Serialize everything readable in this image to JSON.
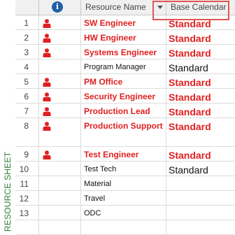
{
  "side_label": "RESOURCE SHEET",
  "header": {
    "info_symbol": "i",
    "resource_name": "Resource Name",
    "base_calendar": "Base Calendar"
  },
  "colors": {
    "overallocated_text": "#e02020",
    "normal_text": "#111111",
    "side_label": "#2e7d32",
    "highlight_box": "#e05555",
    "info_icon": "#1f5fa8"
  },
  "rows": [
    {
      "num": "1",
      "name": "SW Engineer",
      "calendar": "Standard",
      "icon": "person-icon",
      "overallocated": true
    },
    {
      "num": "2",
      "name": "HW Engineer",
      "calendar": "Standard",
      "icon": "person-icon",
      "overallocated": true
    },
    {
      "num": "3",
      "name": "Systems Engineer",
      "calendar": "Standard",
      "icon": "person-icon",
      "overallocated": true
    },
    {
      "num": "4",
      "name": "Program Manager",
      "calendar": "Standard",
      "icon": "",
      "overallocated": false
    },
    {
      "num": "5",
      "name": "PM Office",
      "calendar": "Standard",
      "icon": "person-icon",
      "overallocated": true
    },
    {
      "num": "6",
      "name": "Security Engineer",
      "calendar": "Standard",
      "icon": "person-icon",
      "overallocated": true
    },
    {
      "num": "7",
      "name": "Production Lead",
      "calendar": "Standard",
      "icon": "person-icon",
      "overallocated": true
    },
    {
      "num": "8",
      "name": "Production Support",
      "calendar": "Standard",
      "icon": "person-icon",
      "overallocated": true
    },
    {
      "num": "9",
      "name": "Test Engineer",
      "calendar": "Standard",
      "icon": "person-icon",
      "overallocated": true
    },
    {
      "num": "10",
      "name": "Test Tech",
      "calendar": "Standard",
      "icon": "",
      "overallocated": false
    },
    {
      "num": "11",
      "name": "Material",
      "calendar": "",
      "icon": "",
      "overallocated": false
    },
    {
      "num": "12",
      "name": "Travel",
      "calendar": "",
      "icon": "",
      "overallocated": false
    },
    {
      "num": "13",
      "name": "ODC",
      "calendar": "",
      "icon": "",
      "overallocated": false
    },
    {
      "num": "",
      "name": "",
      "calendar": "",
      "icon": "",
      "overallocated": false
    }
  ]
}
